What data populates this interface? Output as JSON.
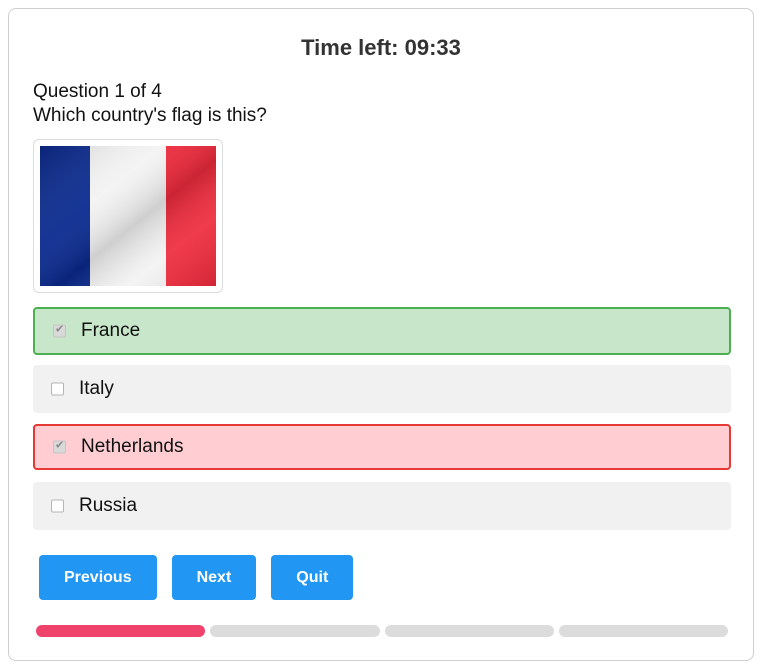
{
  "timer": {
    "label": "Time left: 09:33"
  },
  "question": {
    "counter": "Question 1 of 4",
    "text": "Which country's flag is this?",
    "flag_icon": "flag-france-icon"
  },
  "options": [
    {
      "label": "France",
      "checked": true,
      "state": "correct"
    },
    {
      "label": "Italy",
      "checked": false,
      "state": "neutral"
    },
    {
      "label": "Netherlands",
      "checked": true,
      "state": "wrong"
    },
    {
      "label": "Russia",
      "checked": false,
      "state": "neutral"
    }
  ],
  "buttons": {
    "previous": "Previous",
    "next": "Next",
    "quit": "Quit"
  },
  "progress": {
    "total": 4,
    "current": 1
  },
  "colors": {
    "accent": "#2196f3",
    "correct_bg": "#c8e6c9",
    "correct_border": "#4caf50",
    "wrong_bg": "#ffcdd2",
    "wrong_border": "#e53935",
    "progress_active": "#f0436c",
    "progress_inactive": "#dcdcdc"
  }
}
